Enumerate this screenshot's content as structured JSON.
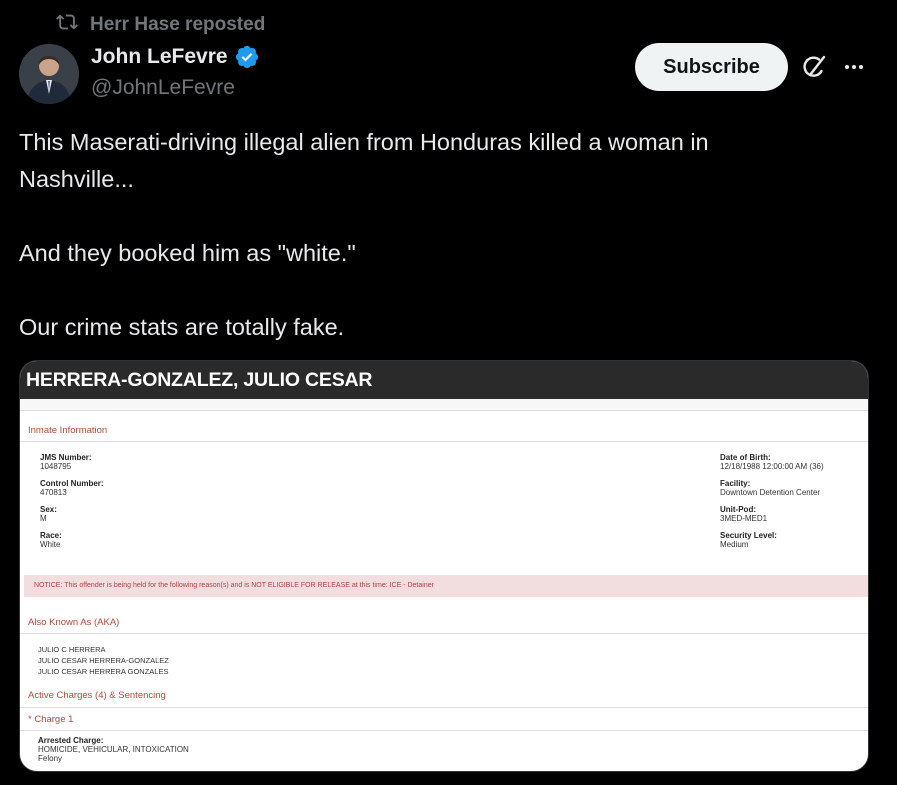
{
  "repost": {
    "label": "Herr Hase reposted"
  },
  "author": {
    "name": "John LeFevre",
    "handle": "@JohnLeFevre"
  },
  "actions": {
    "subscribe_label": "Subscribe"
  },
  "tweet": {
    "line1": "This Maserati-driving illegal alien from Honduras killed a woman in",
    "line2": "Nashville...",
    "line3": "And they booked him as \"white.\"",
    "line4": "Our crime stats are totally fake."
  },
  "media": {
    "title": "HERRERA-GONZALEZ, JULIO CESAR",
    "inmate_section": "Inmate Information",
    "jms_label": "JMS Number:",
    "jms_value": "1048795",
    "control_label": "Control Number:",
    "control_value": "470813",
    "sex_label": "Sex:",
    "sex_value": "M",
    "race_label": "Race:",
    "race_value": "White",
    "dob_label": "Date of Birth:",
    "dob_value": "12/18/1988 12:00:00 AM (36)",
    "facility_label": "Facility:",
    "facility_value": "Downtown Detention Center",
    "unit_label": "Unit-Pod:",
    "unit_value": "3MED-MED1",
    "security_label": "Security Level:",
    "security_value": "Medium",
    "notice": "NOTICE: This offender is being held for the following reason(s) and is NOT ELIGIBLE FOR RELEASE at this time: ICE - Detainer",
    "aka_section": "Also Known As (AKA)",
    "aka": [
      "JULIO C HERRERA",
      "JULIO CESAR HERRERA-GONZALEZ",
      "JULIO CESAR HERRERA GONZALES"
    ],
    "charges_section": "Active Charges (4)  &  Sentencing",
    "charge1": "* Charge 1",
    "arrested_label": "Arrested Charge:",
    "arrested_value": "HOMICIDE, VEHICULAR, INTOXICATION",
    "charge_class": "Felony"
  },
  "colors": {
    "background": "#000000",
    "text": "#e7e9ea",
    "muted": "#71767b",
    "verified": "#1d9bf0",
    "button_bg": "#eff3f4"
  }
}
